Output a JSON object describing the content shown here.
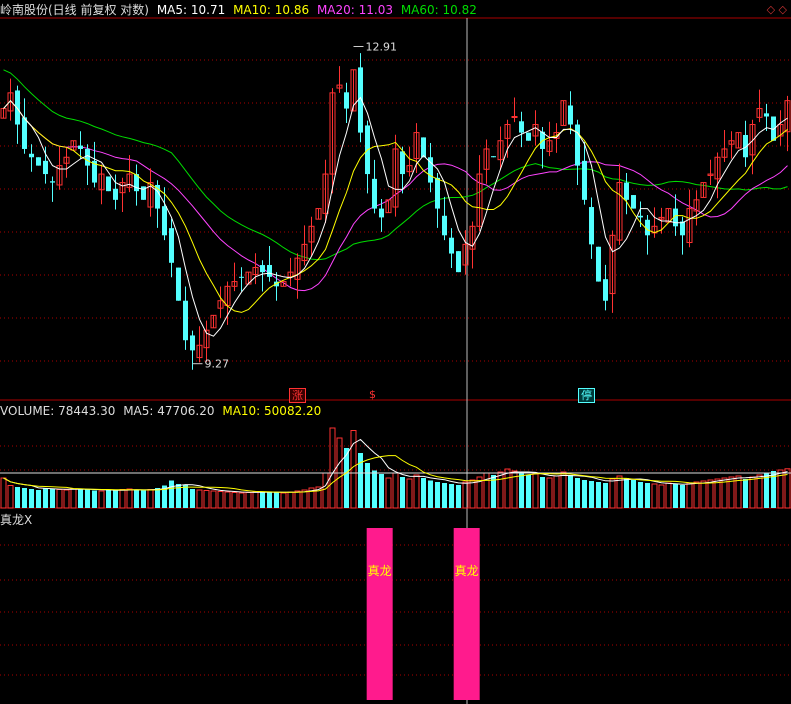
{
  "main_header": {
    "stock_name": "岭南股份(日线 前复权 对数)",
    "ma5": "MA5: 10.71",
    "ma10": "MA10: 10.86",
    "ma20": "MA20: 11.03",
    "ma60": "MA60: 10.82"
  },
  "volume_header": {
    "volume": "VOLUME: 78443.30",
    "ma5": "MA5: 47706.20",
    "ma10": "MA10: 50082.20"
  },
  "indicator_header": {
    "name": "真龙",
    "close_glyph": "X"
  },
  "corner_icon": "◇ ◇",
  "annotations": {
    "high": "12.91",
    "low": "9.27",
    "flag_up": "涨",
    "flag_dollar": "$",
    "flag_stop": "停"
  },
  "colors": {
    "up": "#ff3232",
    "down": "#54ffff",
    "ma5": "#ffffff",
    "ma10": "#ffff00",
    "ma20": "#ff44ff",
    "ma60": "#00dd00",
    "signal": "#ff1b8d",
    "grid": "#aa0000"
  },
  "chart_data": [
    {
      "type": "candlestick",
      "title": "岭南股份(日线 前复权 对数)",
      "y_scale": "log",
      "ylim": [
        9.0,
        13.3
      ],
      "annotated_high": 12.91,
      "annotated_low": 9.27,
      "series": [
        {
          "name": "MA5",
          "last": 10.71
        },
        {
          "name": "MA10",
          "last": 10.86
        },
        {
          "name": "MA20",
          "last": 11.03
        },
        {
          "name": "MA60",
          "last": 10.82
        }
      ],
      "closes": [
        12.1,
        12.3,
        11.9,
        11.6,
        11.5,
        11.4,
        11.3,
        11.2,
        11.4,
        11.5,
        11.7,
        11.6,
        11.4,
        11.2,
        11.3,
        11.1,
        11.0,
        11.2,
        11.3,
        11.1,
        11.0,
        11.2,
        10.9,
        10.6,
        10.3,
        9.9,
        9.5,
        9.4,
        9.45,
        9.6,
        9.75,
        9.9,
        10.05,
        10.1,
        10.15,
        10.2,
        10.25,
        10.2,
        10.15,
        10.05,
        10.1,
        10.2,
        10.35,
        10.5,
        10.7,
        10.9,
        11.3,
        12.3,
        12.4,
        12.1,
        12.6,
        11.8,
        11.3,
        10.9,
        10.8,
        11.0,
        11.6,
        11.3,
        11.4,
        11.8,
        11.5,
        11.2,
        10.9,
        10.6,
        10.4,
        10.2,
        10.5,
        10.7,
        11.3,
        11.6,
        11.5,
        11.7,
        11.9,
        12.0,
        11.8,
        11.7,
        11.9,
        11.6,
        11.7,
        11.8,
        12.2,
        11.9,
        11.4,
        11.0,
        10.5,
        10.1,
        9.9,
        10.6,
        11.2,
        11.0,
        10.9,
        10.8,
        10.6,
        10.7,
        10.8,
        10.9,
        10.7,
        10.6,
        10.9,
        11.0,
        11.2,
        11.3,
        11.5,
        11.6,
        11.7,
        11.8,
        11.5,
        11.9,
        12.1,
        12.0,
        11.7,
        11.9,
        12.2
      ]
    },
    {
      "type": "bar",
      "title": "VOLUME",
      "series": [
        {
          "name": "VOLUME",
          "last": 78443.3
        },
        {
          "name": "MA5",
          "last": 47706.2
        },
        {
          "name": "MA10",
          "last": 50082.2
        }
      ],
      "ylim": [
        0,
        180000
      ],
      "reference_line": 70000,
      "values": [
        60000,
        45000,
        42000,
        40000,
        38000,
        36000,
        40000,
        38000,
        37000,
        36000,
        38000,
        39000,
        37000,
        35000,
        34000,
        36000,
        35000,
        37000,
        38000,
        36000,
        35000,
        37000,
        40000,
        45000,
        55000,
        48000,
        46000,
        38000,
        36000,
        35000,
        34000,
        33000,
        32000,
        31000,
        30000,
        31000,
        32000,
        33000,
        32000,
        31000,
        30000,
        32000,
        34000,
        36000,
        40000,
        42000,
        70000,
        160000,
        140000,
        120000,
        155000,
        110000,
        90000,
        75000,
        68000,
        60000,
        70000,
        62000,
        58000,
        66000,
        60000,
        55000,
        52000,
        50000,
        48000,
        46000,
        52000,
        56000,
        62000,
        70000,
        66000,
        72000,
        78000,
        74000,
        70000,
        66000,
        68000,
        62000,
        60000,
        64000,
        72000,
        66000,
        60000,
        56000,
        54000,
        52000,
        50000,
        58000,
        64000,
        60000,
        56000,
        52000,
        50000,
        48000,
        46000,
        50000,
        48000,
        46000,
        50000,
        52000,
        54000,
        56000,
        58000,
        60000,
        62000,
        64000,
        58000,
        62000,
        66000,
        70000,
        74000,
        76000,
        78443
      ]
    },
    {
      "type": "bar",
      "title": "真龙",
      "series": [
        {
          "name": "真龙",
          "values": [
            1,
            1
          ]
        }
      ],
      "signal_positions": [
        0.48,
        0.59
      ],
      "signal_label": "真龙"
    }
  ]
}
